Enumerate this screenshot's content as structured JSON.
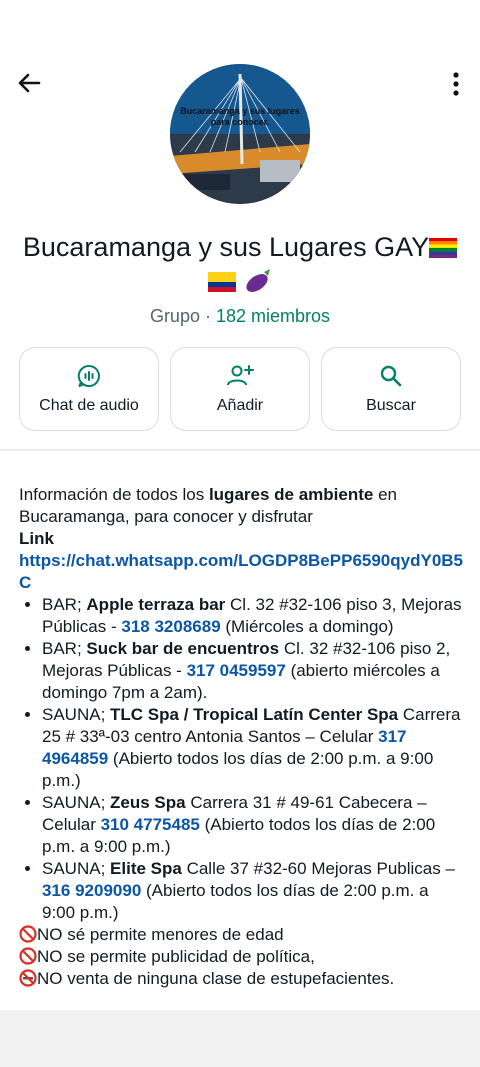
{
  "header": {
    "back_label": "back",
    "more_label": "more options"
  },
  "group": {
    "avatar_text": "Bucaramanga y sus lugares para conocer.",
    "name": "Bucaramanga y sus Lugares GAY",
    "type": "Grupo",
    "separator": "·",
    "members": "182 miembros"
  },
  "actions": [
    {
      "label": "Chat de audio",
      "icon": "audio-chat-icon"
    },
    {
      "label": "Añadir",
      "icon": "add-person-icon"
    },
    {
      "label": "Buscar",
      "icon": "search-icon"
    }
  ],
  "description": {
    "intro_1": "Información de todos los ",
    "intro_bold": "lugares de ambiente",
    "intro_2": " en Bucaramanga, para conocer y disfrutar",
    "link_label": "Link",
    "link_url": "https://chat.whatsapp.com/LOGDP8BePP6590qydY0B5C",
    "items": [
      {
        "prefix": "BAR; ",
        "name": "Apple terraza bar",
        "address": " Cl. 32 #32-106 piso 3, Mejoras Públicas - ",
        "phone": "318 3208689",
        "note": " (Miércoles a domingo)"
      },
      {
        "prefix": "BAR; ",
        "name": "Suck bar de encuentros",
        "address": " Cl. 32 #32-106 piso 2, Mejoras Públicas - ",
        "phone": "317 0459597",
        "note": " (abierto miércoles a domingo 7pm a 2am)."
      },
      {
        "prefix": "SAUNA; ",
        "name": "TLC Spa / Tropical Latín Center Spa",
        "address": " Carrera 25 # 33ª-03 centro Antonia Santos – Celular ",
        "phone": "317 4964859",
        "note": " (Abierto todos los días de 2:00 p.m. a 9:00 p.m.)"
      },
      {
        "prefix": "SAUNA; ",
        "name": "Zeus Spa",
        "address": " Carrera 31 # 49-61 Cabecera – Celular ",
        "phone": "310 4775485",
        "note": " (Abierto todos los días de 2:00 p.m. a 9:00 p.m.)"
      },
      {
        "prefix": "SAUNA; ",
        "name": "Elite Spa",
        "address": " Calle 37 #32-60 Mejoras Publicas – ",
        "phone": "316 9209090",
        "note": " (Abierto todos los días de 2:00 p.m. a 9:00 p.m.)"
      }
    ],
    "rules": [
      "NO sé permite menores de edad",
      "NO se permite publicidad de política,",
      "NO venta de ninguna clase de estupefacientes."
    ]
  },
  "colors": {
    "accent": "#008069",
    "link": "#0b57a6",
    "prohibited": "#d93025"
  }
}
